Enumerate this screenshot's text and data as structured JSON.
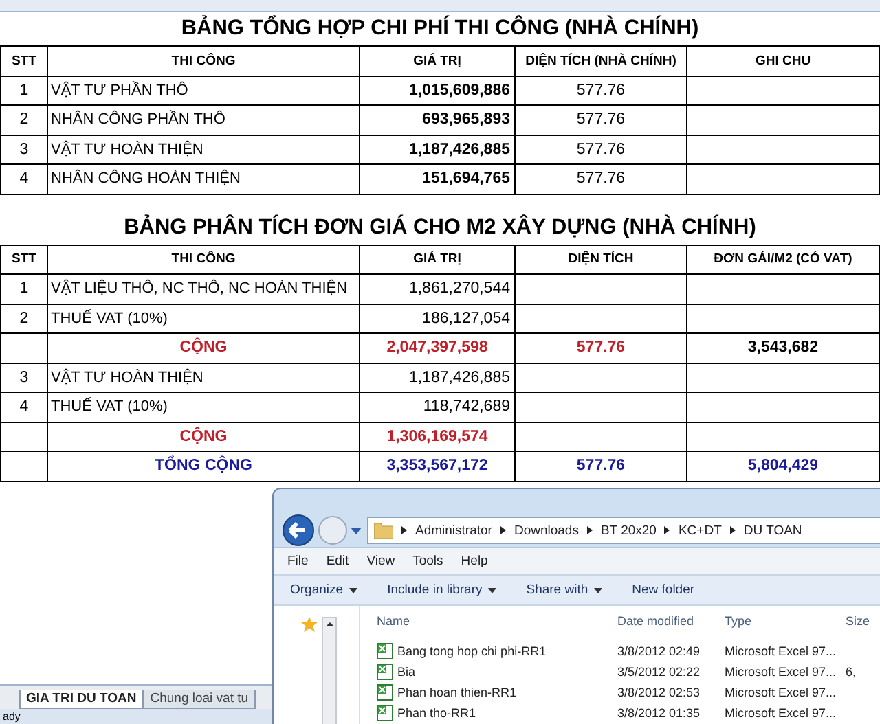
{
  "table1": {
    "title": "BẢNG TỔNG HỢP CHI PHÍ THI CÔNG (NHÀ CHÍNH)",
    "columns": [
      "STT",
      "THI CÔNG",
      "GIÁ TRỊ",
      "DIỆN TÍCH (NHÀ CHÍNH)",
      "GHI CHU"
    ],
    "rows": [
      {
        "stt": "1",
        "item": "VẬT TƯ PHẦN THÔ",
        "value": "1,015,609,886",
        "area": "577.76"
      },
      {
        "stt": "2",
        "item": "NHÂN CÔNG PHẦN THÔ",
        "value": "693,965,893",
        "area": "577.76"
      },
      {
        "stt": "3",
        "item": "VẬT TƯ HOÀN THIỆN",
        "value": "1,187,426,885",
        "area": "577.76"
      },
      {
        "stt": "4",
        "item": "NHÂN CÔNG HOÀN THIỆN",
        "value": "151,694,765",
        "area": "577.76"
      }
    ]
  },
  "table2": {
    "title": "BẢNG PHÂN TÍCH ĐƠN GIÁ CHO M2 XÂY DỰNG (NHÀ CHÍNH)",
    "columns": [
      "STT",
      "THI CÔNG",
      "GIÁ TRỊ",
      "DIỆN TÍCH",
      "ĐƠN GÁI/M2 (CÓ VAT)"
    ],
    "rows": [
      {
        "kind": "item",
        "stt": "1",
        "item": "VẬT LIỆU THÔ, NC THÔ, NC HOÀN THIỆN",
        "value": "1,861,270,544"
      },
      {
        "kind": "item",
        "stt": "2",
        "item": "THUẾ VAT (10%)",
        "value": "186,127,054"
      },
      {
        "kind": "subtotal",
        "item": "CỘNG",
        "value": "2,047,397,598",
        "area": "577.76",
        "unit_price": "3,543,682"
      },
      {
        "kind": "item",
        "stt": "3",
        "item": "VẬT TƯ HOÀN THIỆN",
        "value": "1,187,426,885"
      },
      {
        "kind": "item",
        "stt": "4",
        "item": "THUẾ VAT (10%)",
        "value": "118,742,689"
      },
      {
        "kind": "subtotal",
        "item": "CỘNG",
        "value": "1,306,169,574"
      },
      {
        "kind": "total",
        "item": "TỔNG CỘNG",
        "value": "3,353,567,172",
        "area": "577.76",
        "unit_price": "5,804,429"
      }
    ]
  },
  "sheet_tabs": [
    {
      "label": "GIA TRI DU TOAN",
      "selected": true
    },
    {
      "label": "Chung loai vat tu",
      "selected": false
    }
  ],
  "status_bar": "ady",
  "explorer": {
    "breadcrumb": [
      "Administrator",
      "Downloads",
      "BT 20x20",
      "KC+DT",
      "DU TOAN"
    ],
    "menu": [
      "File",
      "Edit",
      "View",
      "Tools",
      "Help"
    ],
    "toolbar": [
      {
        "label": "Organize",
        "dropdown": true
      },
      {
        "label": "Include in library",
        "dropdown": true
      },
      {
        "label": "Share with",
        "dropdown": true
      },
      {
        "label": "New folder",
        "dropdown": false
      }
    ],
    "columns": [
      "Name",
      "Date modified",
      "Type",
      "Size"
    ],
    "files": [
      {
        "name": "Bang tong hop chi phi-RR1",
        "date": "3/8/2012 02:49",
        "type": "Microsoft Excel 97..."
      },
      {
        "name": "Bia",
        "date": "3/5/2012 02:22",
        "type": "Microsoft Excel 97...",
        "size": "6,"
      },
      {
        "name": "Phan hoan thien-RR1",
        "date": "3/8/2012 02:53",
        "type": "Microsoft Excel 97..."
      },
      {
        "name": "Phan tho-RR1",
        "date": "3/8/2012 01:35",
        "type": "Microsoft Excel 97..."
      }
    ]
  }
}
